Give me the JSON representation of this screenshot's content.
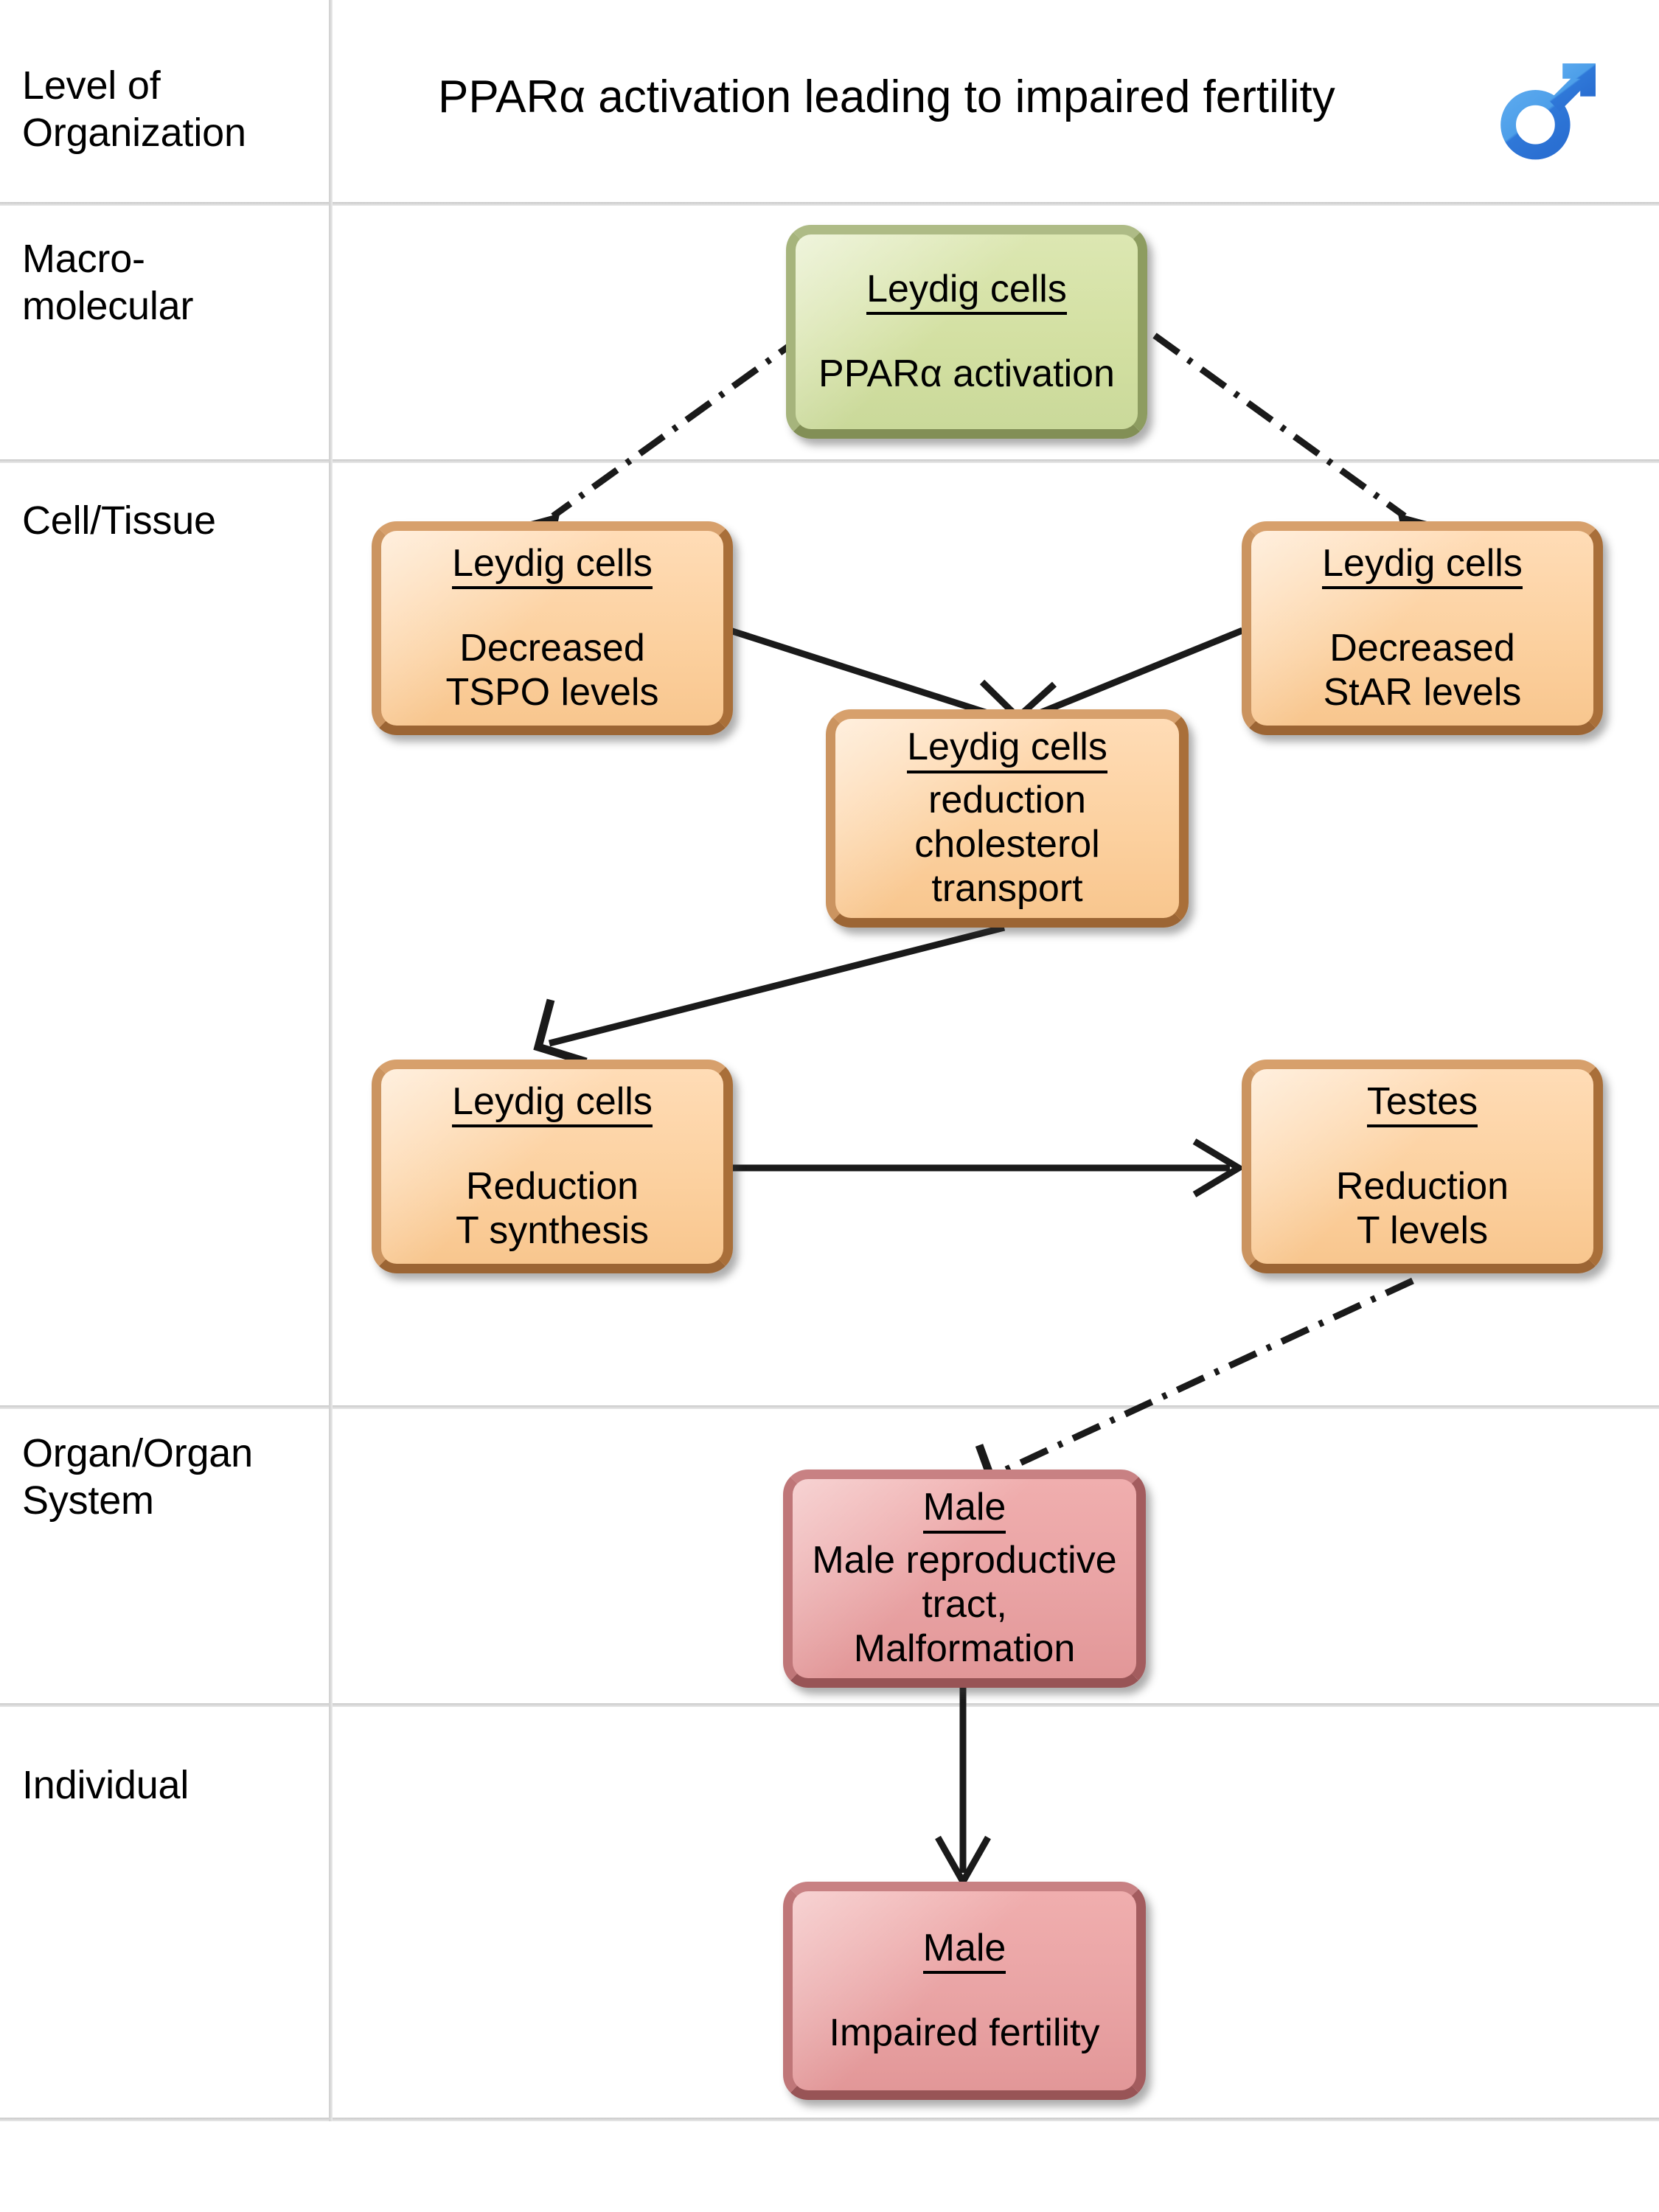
{
  "header": {
    "row_header_label": "Level of\nOrganization",
    "title": "PPARα activation leading to impaired fertility",
    "icon": "male-symbol-icon"
  },
  "colors": {
    "green_fill": "#d3e0a2",
    "green_border": "#9aa96d",
    "orange_fill": "#fcd1a0",
    "orange_border": "#b5793f",
    "pink_fill": "#e9a3a4",
    "pink_border": "#ad6567",
    "grid_line": "#d6d6d6",
    "arrow": "#1a1a1a",
    "male_icon_light": "#4da2ec",
    "male_icon_dark": "#2a72d4"
  },
  "rows": [
    {
      "label": "Macro-\nmolecular"
    },
    {
      "label": "Cell/Tissue"
    },
    {
      "label": "Organ/Organ\nSystem"
    },
    {
      "label": "Individual"
    }
  ],
  "nodes": [
    {
      "id": "ppar-activation",
      "level": "Macro-molecular",
      "color": "green",
      "title": "Leydig cells",
      "body": "PPARα activation"
    },
    {
      "id": "tspo-decrease",
      "level": "Cell/Tissue",
      "color": "orange",
      "title": "Leydig cells",
      "body": "Decreased\nTSPO levels"
    },
    {
      "id": "star-decrease",
      "level": "Cell/Tissue",
      "color": "orange",
      "title": "Leydig cells",
      "body": "Decreased\nStAR levels"
    },
    {
      "id": "cholesterol-transport",
      "level": "Cell/Tissue",
      "color": "orange",
      "title": "Leydig cells",
      "body": "reduction\ncholesterol\ntransport"
    },
    {
      "id": "t-synthesis",
      "level": "Cell/Tissue",
      "color": "orange",
      "title": "Leydig cells",
      "body": "Reduction\nT synthesis"
    },
    {
      "id": "t-levels",
      "level": "Cell/Tissue",
      "color": "orange",
      "title": "Testes",
      "body": "Reduction\nT levels"
    },
    {
      "id": "tract-malformation",
      "level": "Organ/Organ System",
      "color": "pink",
      "title": "Male",
      "body": "Male reproductive\ntract,\nMalformation"
    },
    {
      "id": "impaired-fertility",
      "level": "Individual",
      "color": "pink",
      "title": "Male",
      "body": "Impaired fertility"
    }
  ],
  "edges": [
    {
      "from": "ppar-activation",
      "to": "tspo-decrease",
      "style": "dash-dot"
    },
    {
      "from": "ppar-activation",
      "to": "star-decrease",
      "style": "dash-dot"
    },
    {
      "from": "tspo-decrease",
      "to": "cholesterol-transport",
      "style": "solid"
    },
    {
      "from": "star-decrease",
      "to": "cholesterol-transport",
      "style": "solid"
    },
    {
      "from": "cholesterol-transport",
      "to": "t-synthesis",
      "style": "solid"
    },
    {
      "from": "t-synthesis",
      "to": "t-levels",
      "style": "solid"
    },
    {
      "from": "t-levels",
      "to": "tract-malformation",
      "style": "dash-dot"
    },
    {
      "from": "tract-malformation",
      "to": "impaired-fertility",
      "style": "solid"
    }
  ]
}
